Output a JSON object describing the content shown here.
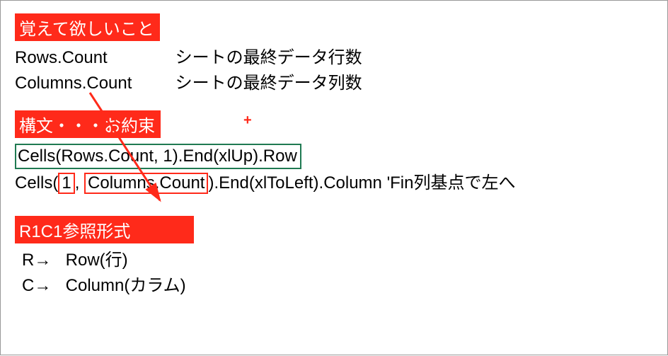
{
  "section1": {
    "header": "覚えて欲しいこと",
    "rows": [
      {
        "code": "Rows.Count",
        "desc": "シートの最終データ行数"
      },
      {
        "code": "Columns.Count",
        "desc": "シートの最終データ列数"
      }
    ]
  },
  "plus_mark": "+",
  "section2": {
    "header": "構文・・・お約束",
    "line1": "Cells(Rows.Count, 1).End(xlUp).Row",
    "line2": {
      "pre": "Cells(",
      "box1": "1",
      "mid": ", ",
      "box2": "Columns.Count",
      "post_code": ").End(xlToLeft).Column ",
      "comment": "'Fin列基点で左へ"
    }
  },
  "section3": {
    "header": "R1C1参照形式",
    "rows": [
      {
        "label": "R→",
        "value": "Row(行)"
      },
      {
        "label": "C→",
        "value": "Column(カラム)"
      }
    ]
  }
}
